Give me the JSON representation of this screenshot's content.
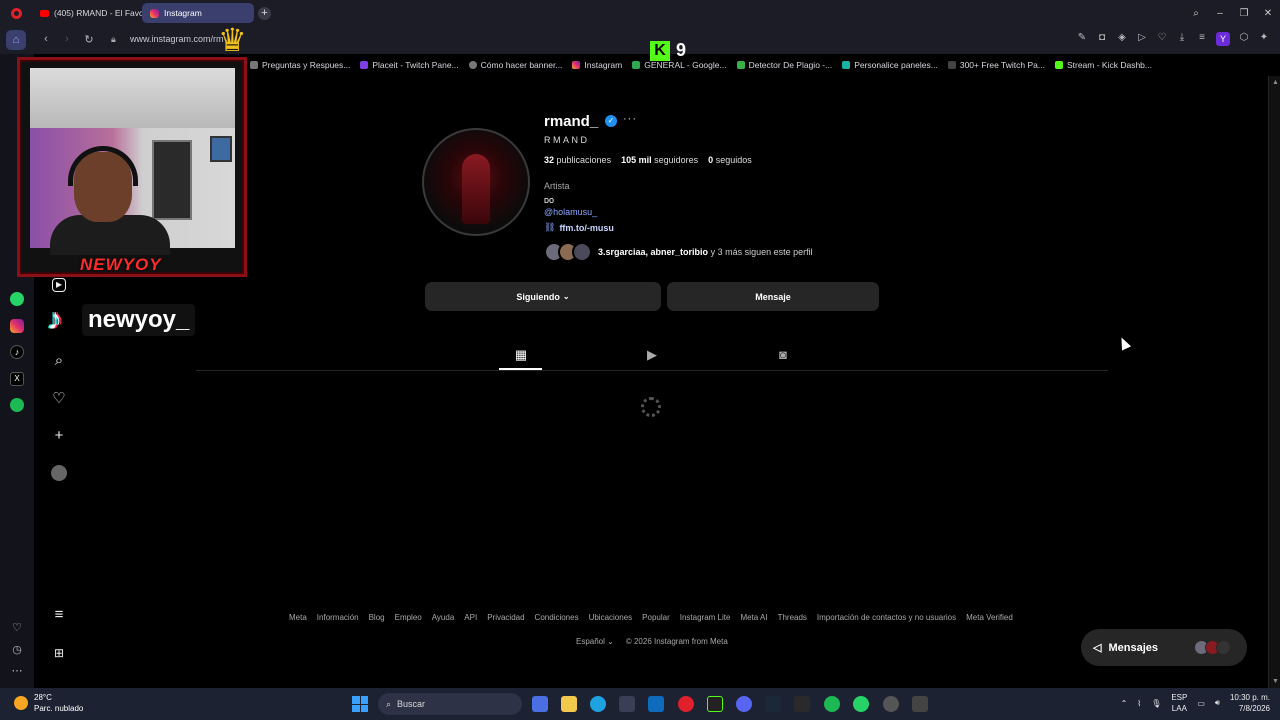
{
  "browser": {
    "tabs": [
      {
        "label": "(405) RMAND - El Favorit",
        "icon": "youtube-icon"
      },
      {
        "label": "Instagram",
        "icon": "instagram-icon"
      }
    ],
    "url": "www.instagram.com/rm"
  },
  "bookmarks": [
    "Preguntas y Respues...",
    "Placeit - Twitch Pane...",
    "Cómo hacer banner...",
    "Instagram",
    "GENERAL - Google...",
    "Detector De Plagio -...",
    "Personalice paneles...",
    "300+ Free Twitch Pa...",
    "Stream - Kick Dashb..."
  ],
  "profile": {
    "username": "rmand_",
    "verified_mark": "✓",
    "more": "···",
    "full_name": "RMAND",
    "posts_count": "32",
    "posts_label": "publicaciones",
    "followers_count": "105 mil",
    "followers_label": "seguidores",
    "following_count": "0",
    "following_label": "seguidos",
    "category": "Artista",
    "bio": "ᴅᴏ",
    "mention": "@holamusu_",
    "link": "ffm.to/-musu",
    "followed_by_names": "3.srgarciaa, abner_toribio",
    "followed_by_rest": "y 3 más siguen este perfil"
  },
  "buttons": {
    "following": "Siguiendo",
    "following_chevron": "⌄",
    "message": "Mensaje"
  },
  "footer": {
    "links": [
      "Meta",
      "Información",
      "Blog",
      "Empleo",
      "Ayuda",
      "API",
      "Privacidad",
      "Condiciones",
      "Ubicaciones",
      "Popular",
      "Instagram Lite",
      "Meta AI",
      "Threads",
      "Importación de contactos y no usuarios",
      "Meta Verified"
    ],
    "language": "Español",
    "copyright": "© 2026 Instagram from Meta"
  },
  "messages_widget": {
    "label": "Mensajes"
  },
  "overlay": {
    "webcam_banner": "NEWYOY",
    "kick_letter": "K",
    "kick_viewers": "9",
    "tiktok_handle": "newyoy_"
  },
  "taskbar": {
    "temperature": "28°C",
    "weather": "Parc. nublado",
    "search_placeholder": "Buscar",
    "lang_top": "ESP",
    "lang_bottom": "LAA",
    "time": "10:30 p. m.",
    "date": "7/8/2026"
  },
  "colors": {
    "accent_blue": "#1f8ff0",
    "button_gray": "#262626",
    "kick_green": "#53fc18",
    "overlay_red": "#8b0f14"
  }
}
